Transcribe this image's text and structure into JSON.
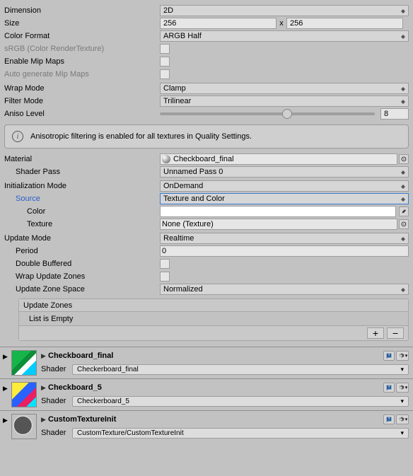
{
  "dimension": {
    "label": "Dimension",
    "value": "2D"
  },
  "size": {
    "label": "Size",
    "x": "256",
    "y": "256",
    "sep": "x"
  },
  "color_format": {
    "label": "Color Format",
    "value": "ARGB Half"
  },
  "srgb": {
    "label": "sRGB (Color RenderTexture)"
  },
  "mipmaps": {
    "label": "Enable Mip Maps"
  },
  "auto_mip": {
    "label": "Auto generate Mip Maps"
  },
  "wrap": {
    "label": "Wrap Mode",
    "value": "Clamp"
  },
  "filter": {
    "label": "Filter Mode",
    "value": "Trilinear"
  },
  "aniso": {
    "label": "Aniso Level",
    "value": "8"
  },
  "info": "Anisotropic filtering is enabled for all textures in Quality Settings.",
  "material": {
    "label": "Material",
    "value": "Checkboard_final"
  },
  "shader_pass": {
    "label": "Shader Pass",
    "value": "Unnamed Pass 0"
  },
  "init_mode": {
    "label": "Initialization Mode",
    "value": "OnDemand"
  },
  "source": {
    "label": "Source",
    "value": "Texture and Color"
  },
  "color": {
    "label": "Color"
  },
  "texture": {
    "label": "Texture",
    "value": "None (Texture)"
  },
  "update_mode": {
    "label": "Update Mode",
    "value": "Realtime"
  },
  "period": {
    "label": "Period",
    "value": "0"
  },
  "dbl_buf": {
    "label": "Double Buffered"
  },
  "wrap_zones": {
    "label": "Wrap Update Zones"
  },
  "zone_space": {
    "label": "Update Zone Space",
    "value": "Normalized"
  },
  "zones": {
    "header": "Update Zones",
    "empty": "List is Empty"
  },
  "shader_label": "Shader",
  "mats": [
    {
      "name": "Checkboard_final",
      "shader": "Checkerboard_final"
    },
    {
      "name": "Checkboard_5",
      "shader": "Checkerboard_5"
    },
    {
      "name": "CustomTextureInit",
      "shader": "CustomTexture/CustomTextureInit"
    }
  ]
}
